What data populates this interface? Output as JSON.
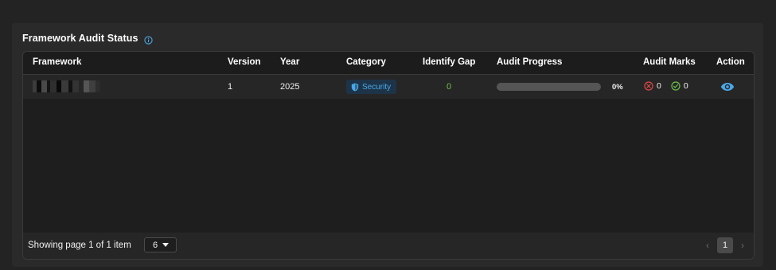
{
  "panel": {
    "title": "Framework Audit Status",
    "info_icon": "info-circle-icon"
  },
  "table": {
    "columns": [
      "Framework",
      "Version",
      "Year",
      "Category",
      "Identify Gap",
      "Audit Progress",
      "Audit Marks",
      "Action"
    ],
    "rows": [
      {
        "framework": "",
        "version": "1",
        "year": "2025",
        "category": "Security",
        "category_icon": "shield-icon",
        "identify_gap": "0",
        "audit_progress_percent": 0,
        "audit_progress_label": "0%",
        "marks_failed": "0",
        "marks_passed": "0",
        "action_icon": "eye-icon"
      }
    ]
  },
  "footer": {
    "showing_text": "Showing page 1 of 1 item",
    "page_size": "6",
    "current_page": "1",
    "prev_icon": "chevron-left-icon",
    "next_icon": "chevron-right-icon"
  },
  "colors": {
    "accent": "#4aa8e8",
    "success": "#6cc04a",
    "danger": "#e04848",
    "panel_bg": "#2a2a2a",
    "table_bg": "#1e1e1e"
  }
}
